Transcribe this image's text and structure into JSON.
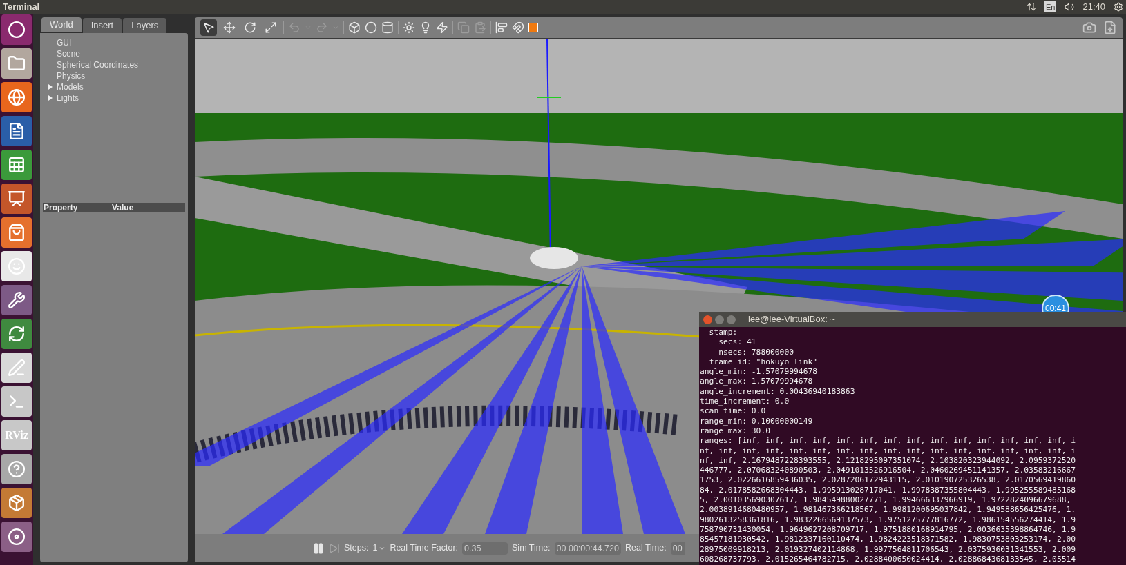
{
  "top_bar": {
    "title": "Terminal",
    "keyboard": "En",
    "time": "21:40"
  },
  "launcher": [
    {
      "kind": "ubuntu"
    },
    {
      "kind": "files"
    },
    {
      "kind": "browser"
    },
    {
      "kind": "writer"
    },
    {
      "kind": "calc"
    },
    {
      "kind": "impress"
    },
    {
      "kind": "store"
    },
    {
      "kind": "amazon"
    },
    {
      "kind": "settings"
    },
    {
      "kind": "updater"
    },
    {
      "kind": "editor"
    },
    {
      "kind": "terminal"
    },
    {
      "kind": "rviz",
      "label": "RViz"
    },
    {
      "kind": "help"
    },
    {
      "kind": "box"
    },
    {
      "kind": "disc"
    }
  ],
  "left_panel": {
    "tabs": [
      {
        "label": "World",
        "selected": true
      },
      {
        "label": "Insert",
        "selected": false
      },
      {
        "label": "Layers",
        "selected": false
      }
    ],
    "tree": [
      {
        "label": "GUI",
        "kind": "leaf"
      },
      {
        "label": "Scene",
        "kind": "leaf"
      },
      {
        "label": "Spherical Coordinates",
        "kind": "leaf"
      },
      {
        "label": "Physics",
        "kind": "leaf"
      },
      {
        "label": "Models",
        "kind": "group",
        "expanded": false
      },
      {
        "label": "Lights",
        "kind": "group",
        "expanded": false
      }
    ],
    "property_header": [
      "Property",
      "Value"
    ]
  },
  "toolbar": [
    {
      "kind": "select",
      "selected": true
    },
    {
      "kind": "translate",
      "selected": false
    },
    {
      "kind": "rotate",
      "selected": false
    },
    {
      "kind": "scale",
      "selected": false
    }
  ],
  "timer_badge": "00:41",
  "bottom_bar": {
    "steps_label": "Steps:",
    "steps_value": "1",
    "rtf_label": "Real Time Factor:",
    "rtf_value": "0.35",
    "sim_label": "Sim Time:",
    "sim_value": "00 00:00:44.720",
    "real_label": "Real Time:",
    "real_value": "00"
  },
  "terminal": {
    "title": "lee@lee-VirtualBox: ~",
    "lines": [
      "  stamp:",
      "    secs: 41",
      "    nsecs: 788000000",
      "  frame_id: \"hokuyo_link\"",
      "angle_min: -1.57079994678",
      "angle_max: 1.57079994678",
      "angle_increment: 0.00436940183863",
      "time_increment: 0.0",
      "scan_time: 0.0",
      "range_min: 0.10000000149",
      "range_max: 30.0",
      "ranges: [inf, inf, inf, inf, inf, inf, inf, inf, inf, inf, inf, inf, inf, inf, i",
      "nf, inf, inf, inf, inf, inf, inf, inf, inf, inf, inf, inf, inf, inf, inf, inf, i",
      "nf, inf, 2.1679487228393555, 2.1218295097351074, 2.103820323944092, 2.0959372520",
      "446777, 2.070683240890503, 2.0491013526916504, 2.0460269451141357, 2.03583216667",
      "1753, 2.0226616859436035, 2.0287206172943115, 2.010190725326538, 2.0170569419860",
      "84, 2.0178582668304443, 1.995913028717041, 1.9978387355804443, 1.995255589485168",
      "5, 2.001035690307617, 1.984549880027771, 1.994666337966919, 1.9722824096679688,",
      "2.0038914680480957, 1.981467366218567, 1.9981200695037842, 1.949588656425476, 1.",
      "9802613258361816, 1.9832266569137573, 1.9751275777816772, 1.986154556274414, 1.9",
      "758790731430054, 1.9649627208709717, 1.9751880168914795, 2.0036635398864746, 1.9",
      "85457181930542, 1.9812337160110474, 1.9824223518371582, 1.9830753803253174, 2.00",
      "28975009918213, 2.019327402114868, 1.9977564811706543, 2.0375936031341553, 2.009",
      "608268737793, 2.015265464782715, 2.0288400650024414, 2.0288684368133545, 2.05514"
    ]
  }
}
